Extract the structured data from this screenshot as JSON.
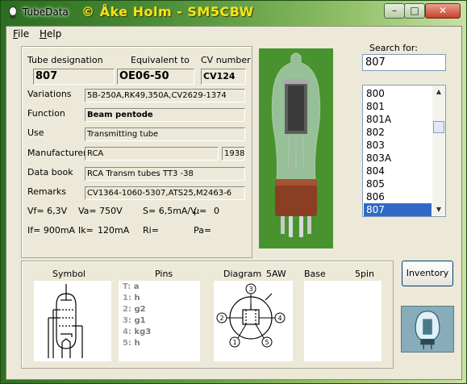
{
  "window": {
    "app_title": "TubeData",
    "author_banner": "© Åke Holm - SM5CBW",
    "minimize_glyph": "–",
    "maximize_glyph": "□",
    "close_glyph": "✕"
  },
  "menu": [
    {
      "label_u": "F",
      "label_rest": "ile"
    },
    {
      "label_u": "H",
      "label_rest": "elp"
    }
  ],
  "tube": {
    "designation_label": "Tube designation",
    "designation": "807",
    "equivalent_label": "Equivalent to",
    "equivalent": "OE06-50",
    "cv_label": "CV number",
    "cv": "CV124",
    "variations_label": "Variations",
    "variations": "5B-250A,RK49,350A,CV2629-1374",
    "function_label": "Function",
    "function": "Beam pentode",
    "use_label": "Use",
    "use": "Transmitting tube",
    "manufacturer_label": "Manufacturer",
    "manufacturer": "RCA",
    "year": "1938",
    "databook_label": "Data book",
    "databook": "RCA Transm tubes TT3 -38",
    "remarks_label": "Remarks",
    "remarks": "CV1364-1060-5307,ATS25,M2463-6",
    "params_row1": [
      "Vf= 6,3V",
      "Va= 750V",
      "S= 6,5mA/V",
      "µ=",
      "0"
    ],
    "params_row2": [
      "If= 900mA",
      "Ik=",
      "120mA",
      "Ri=",
      "Pa="
    ]
  },
  "search": {
    "label": "Search for:",
    "value": "807"
  },
  "list": {
    "items": [
      "800",
      "801",
      "801A",
      "802",
      "803",
      "803A",
      "804",
      "805",
      "806",
      "807"
    ],
    "selected": "807"
  },
  "bottom": {
    "symbol_label": "Symbol",
    "pins_label": "Pins",
    "diagram_label": "Diagram",
    "diagram_code": "5AW",
    "base_label": "Base",
    "base_value": "5pin",
    "pins": [
      {
        "key": "T:",
        "val": "a"
      },
      {
        "key": "1:",
        "val": "h"
      },
      {
        "key": "2:",
        "val": "g2"
      },
      {
        "key": "3:",
        "val": "g1"
      },
      {
        "key": "4:",
        "val": "kg3"
      },
      {
        "key": "5:",
        "val": "h"
      }
    ],
    "diagram_pins": [
      "1",
      "2",
      "3",
      "4",
      "5"
    ]
  },
  "inventory_button": "Inventory",
  "colors": {
    "selection": "#316ac5",
    "title_author": "#f7e41c"
  }
}
